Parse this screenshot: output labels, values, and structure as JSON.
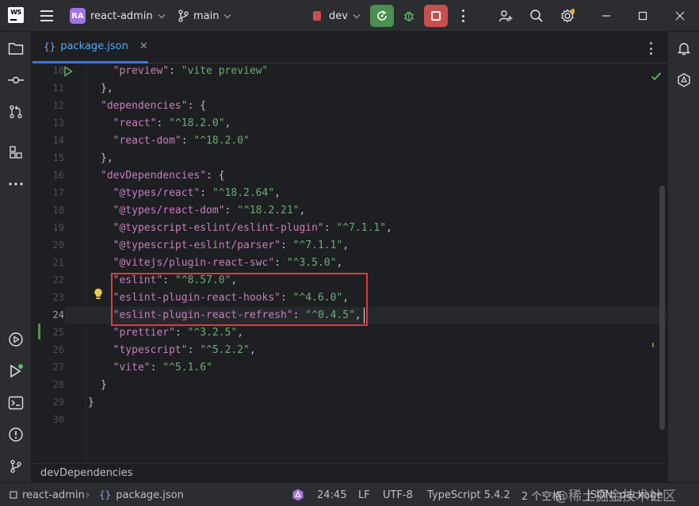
{
  "titlebar": {
    "app_logo": "WS",
    "project_badge": "RA",
    "project_name": "react-admin",
    "branch": "main",
    "run_config": "dev",
    "icons": [
      "hamburger-menu-icon",
      "branch-icon",
      "rerun-icon",
      "debug-icon",
      "stop-icon",
      "more-icon",
      "add-user-icon",
      "search-icon",
      "settings-icon",
      "minimize-icon",
      "maximize-icon",
      "close-icon"
    ]
  },
  "tab": {
    "icon": "{}",
    "label": "package.json",
    "close": "✕"
  },
  "editor": {
    "lines": [
      {
        "n": "10",
        "parts": [
          [
            "p",
            "  "
          ],
          [
            "k",
            "\"preview\""
          ],
          [
            "p",
            ": "
          ],
          [
            "s",
            "\"vite preview\""
          ]
        ]
      },
      {
        "n": "11",
        "parts": [
          [
            "p",
            "},"
          ]
        ]
      },
      {
        "n": "12",
        "parts": [
          [
            "k",
            "\"dependencies\""
          ],
          [
            "p",
            ": {"
          ]
        ]
      },
      {
        "n": "13",
        "parts": [
          [
            "p",
            "  "
          ],
          [
            "k",
            "\"react\""
          ],
          [
            "p",
            ": "
          ],
          [
            "s",
            "\"^18.2.0\""
          ],
          [
            "p",
            ","
          ]
        ]
      },
      {
        "n": "14",
        "parts": [
          [
            "p",
            "  "
          ],
          [
            "k",
            "\"react-dom\""
          ],
          [
            "p",
            ": "
          ],
          [
            "s",
            "\"^18.2.0\""
          ]
        ]
      },
      {
        "n": "15",
        "parts": [
          [
            "p",
            "},"
          ]
        ]
      },
      {
        "n": "16",
        "parts": [
          [
            "k",
            "\"devDependencies\""
          ],
          [
            "p",
            ": {"
          ]
        ]
      },
      {
        "n": "17",
        "parts": [
          [
            "p",
            "  "
          ],
          [
            "k",
            "\"@types/react\""
          ],
          [
            "p",
            ": "
          ],
          [
            "s",
            "\"^18.2.64\""
          ],
          [
            "p",
            ","
          ]
        ]
      },
      {
        "n": "18",
        "parts": [
          [
            "p",
            "  "
          ],
          [
            "k",
            "\"@types/react-dom\""
          ],
          [
            "p",
            ": "
          ],
          [
            "s",
            "\"^18.2.21\""
          ],
          [
            "p",
            ","
          ]
        ]
      },
      {
        "n": "19",
        "parts": [
          [
            "p",
            "  "
          ],
          [
            "k",
            "\"@typescript-eslint/eslint-plugin\""
          ],
          [
            "p",
            ": "
          ],
          [
            "s",
            "\"^7.1.1\""
          ],
          [
            "p",
            ","
          ]
        ]
      },
      {
        "n": "20",
        "parts": [
          [
            "p",
            "  "
          ],
          [
            "k",
            "\"@typescript-eslint/parser\""
          ],
          [
            "p",
            ": "
          ],
          [
            "s",
            "\"^7.1.1\""
          ],
          [
            "p",
            ","
          ]
        ]
      },
      {
        "n": "21",
        "parts": [
          [
            "p",
            "  "
          ],
          [
            "k",
            "\"@vitejs/plugin-react-swc\""
          ],
          [
            "p",
            ": "
          ],
          [
            "s",
            "\"^3.5.0\""
          ],
          [
            "p",
            ","
          ]
        ]
      },
      {
        "n": "22",
        "parts": [
          [
            "p",
            "  "
          ],
          [
            "k",
            "\"eslint\""
          ],
          [
            "p",
            ": "
          ],
          [
            "s",
            "\"^8.57.0\""
          ],
          [
            "p",
            ","
          ]
        ]
      },
      {
        "n": "23",
        "parts": [
          [
            "p",
            "  "
          ],
          [
            "k",
            "\"eslint-plugin-react-hooks\""
          ],
          [
            "p",
            ": "
          ],
          [
            "s",
            "\"^4.6.0\""
          ],
          [
            "p",
            ","
          ]
        ]
      },
      {
        "n": "24",
        "parts": [
          [
            "p",
            "  "
          ],
          [
            "k",
            "\"eslint-plugin-react-refresh\""
          ],
          [
            "p",
            ": "
          ],
          [
            "s",
            "\"^0.4.5\""
          ],
          [
            "p",
            ","
          ]
        ]
      },
      {
        "n": "25",
        "parts": [
          [
            "p",
            "  "
          ],
          [
            "k",
            "\"prettier\""
          ],
          [
            "p",
            ": "
          ],
          [
            "s",
            "\"^3.2.5\""
          ],
          [
            "p",
            ","
          ]
        ]
      },
      {
        "n": "26",
        "parts": [
          [
            "p",
            "  "
          ],
          [
            "k",
            "\"typescript\""
          ],
          [
            "p",
            ": "
          ],
          [
            "s",
            "\"^5.2.2\""
          ],
          [
            "p",
            ","
          ]
        ]
      },
      {
        "n": "27",
        "parts": [
          [
            "p",
            "  "
          ],
          [
            "k",
            "\"vite\""
          ],
          [
            "p",
            ": "
          ],
          [
            "s",
            "\"^5.1.6\""
          ]
        ]
      },
      {
        "n": "28",
        "parts": [
          [
            "p",
            "}"
          ]
        ]
      },
      {
        "n": "29",
        "parts": [
          [
            "p",
            "}"
          ]
        ]
      },
      {
        "n": "30",
        "parts": []
      }
    ],
    "current_line": "24"
  },
  "breadcrumb": "devDependencies",
  "statusbar": {
    "project": "react-admin",
    "file": "package.json",
    "position": "24:45",
    "line_separator": "LF",
    "encoding": "UTF-8",
    "language": "TypeScript 5.4.2",
    "indent": "2 个空格",
    "schema": "JSON: package"
  },
  "watermark": "@稀土掘金技术社区"
}
